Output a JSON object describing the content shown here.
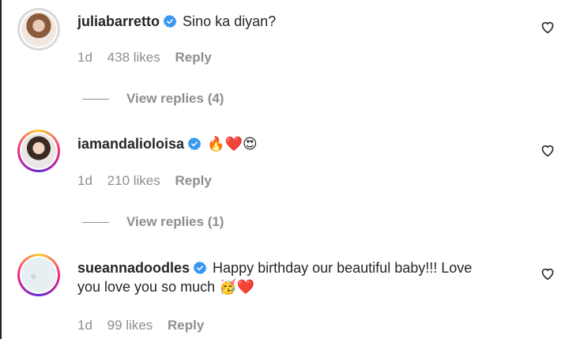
{
  "comments": [
    {
      "username": "juliabarretto",
      "text": "Sino ka diyan?",
      "time": "1d",
      "likes": "438 likes",
      "reply": "Reply",
      "view_replies": "View replies (4)",
      "avatar_ring": "grey"
    },
    {
      "username": "iamandalioloisa",
      "text": "🔥❤️😍",
      "time": "1d",
      "likes": "210 likes",
      "reply": "Reply",
      "view_replies": "View replies (1)",
      "avatar_ring": "story"
    },
    {
      "username": "sueannadoodles",
      "text_line1": "Happy birthday our beautiful baby!!! Love",
      "text_line2": "you love you so much 🥳❤️",
      "time": "1d",
      "likes": "99 likes",
      "reply": "Reply",
      "avatar_ring": "story"
    }
  ],
  "colors": {
    "primary_text": "#262626",
    "secondary_text": "#8e8e8e",
    "verified_badge": "#3897f0"
  },
  "icons": {
    "verified": "verified-badge-icon",
    "like": "heart-outline-icon"
  }
}
